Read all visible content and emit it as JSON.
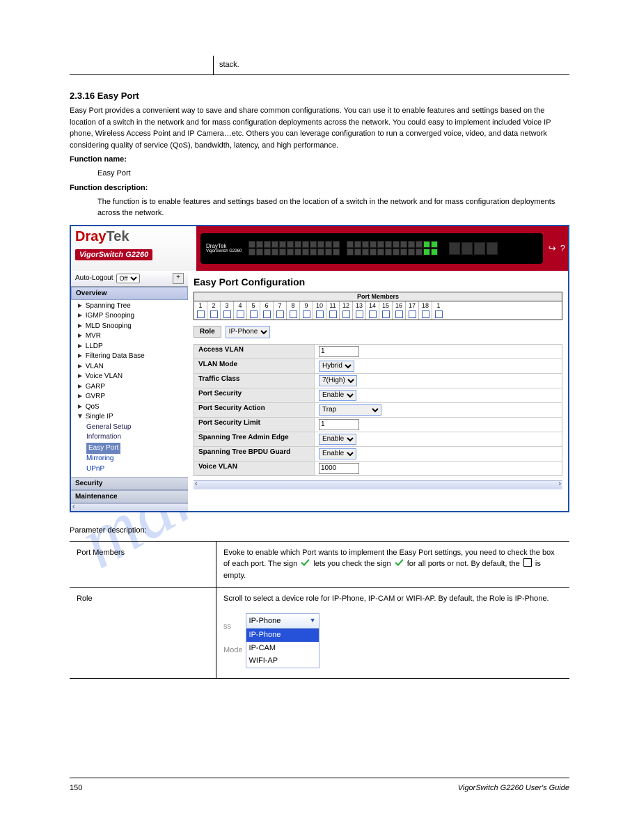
{
  "intro_row": {
    "k": "",
    "v": "stack."
  },
  "section_title": "2.3.16 Easy Port",
  "intro_paragraphs": [
    "Easy Port provides a convenient way to save and share common configurations. You can use it to enable features and settings based on the location of a switch in the network and for mass configuration deployments across the network. You could easy to implement included Voice IP phone, Wireless Access Point and IP Camera…etc. Others you can leverage configuration to run a converged voice, video, and data network considering quality of service (QoS), bandwidth, latency, and high performance."
  ],
  "function_heading": "Function name:",
  "function_value": "Easy Port",
  "function_desc_heading": "Function description:",
  "function_desc_value": "The function is to enable features and settings based on the location of a switch in the network and for mass configuration deployments across the network.",
  "screenshot": {
    "brand_a": "Dray",
    "brand_b": "Tek",
    "product": "VigorSwitch G2260",
    "device_brand": "DrayTek",
    "device_model": "VigorSwitch G2260",
    "auto_logout_label": "Auto-Logout",
    "auto_logout_value": "Off",
    "overview_label": "Overview",
    "tree_items": [
      "Spanning Tree",
      "IGMP Snooping",
      "MLD Snooping",
      "MVR",
      "LLDP",
      "Filtering Data Base",
      "VLAN",
      "Voice VLAN",
      "GARP",
      "GVRP",
      "QoS"
    ],
    "single_ip_label": "Single IP",
    "single_ip_children": [
      "General Setup",
      "Information"
    ],
    "easy_port_label": "Easy Port",
    "after_items": [
      "Mirroring",
      "UPnP"
    ],
    "cat_security": "Security",
    "cat_maintenance": "Maintenance",
    "main_title": "Easy Port Configuration",
    "port_members_label": "Port Members",
    "ports": [
      "1",
      "2",
      "3",
      "4",
      "5",
      "6",
      "7",
      "8",
      "9",
      "10",
      "11",
      "12",
      "13",
      "14",
      "15",
      "16",
      "17",
      "18",
      "1"
    ],
    "role_label": "Role",
    "role_value": "IP-Phone",
    "cfg": {
      "access_vlan_k": "Access VLAN",
      "access_vlan_v": "1",
      "vlan_mode_k": "VLAN Mode",
      "vlan_mode_v": "Hybrid",
      "traffic_class_k": "Traffic Class",
      "traffic_class_v": "7(High)",
      "port_sec_k": "Port Security",
      "port_sec_v": "Enable",
      "port_sec_action_k": "Port Security Action",
      "port_sec_action_v": "Trap",
      "port_sec_limit_k": "Port Security Limit",
      "port_sec_limit_v": "1",
      "stp_edge_k": "Spanning Tree Admin Edge",
      "stp_edge_v": "Enable",
      "stp_bpdu_k": "Spanning Tree BPDU Guard",
      "stp_bpdu_v": "Enable",
      "voice_vlan_k": "Voice VLAN",
      "voice_vlan_v": "1000"
    }
  },
  "param_explain": "Parameter description:",
  "param_rows": [
    {
      "k": "Port Members",
      "v_pre": "Evoke to enable which Port wants to implement the Easy Port settings, you need to check the box of each port. The sign ",
      "v_mid": " lets you check the sign  ",
      "v_mid2": " for all ports or not. By default, the",
      "v_post": " is empty.",
      "has_tick": true,
      "has_box": true
    },
    {
      "k": "Role",
      "v_pre": "Scroll to select a device role for IP-Phone, IP-CAM or WIFI-AP. By default, the Role is IP-Phone.",
      "dropdown": {
        "value": "IP-Phone",
        "opts": [
          "IP-Phone",
          "IP-CAM",
          "WIFI-AP"
        ]
      },
      "extra_left": "ss",
      "extra_bottom": "Mode"
    }
  ],
  "footer_left": "150",
  "footer_right": "VigorSwitch G2260 User's Guide"
}
